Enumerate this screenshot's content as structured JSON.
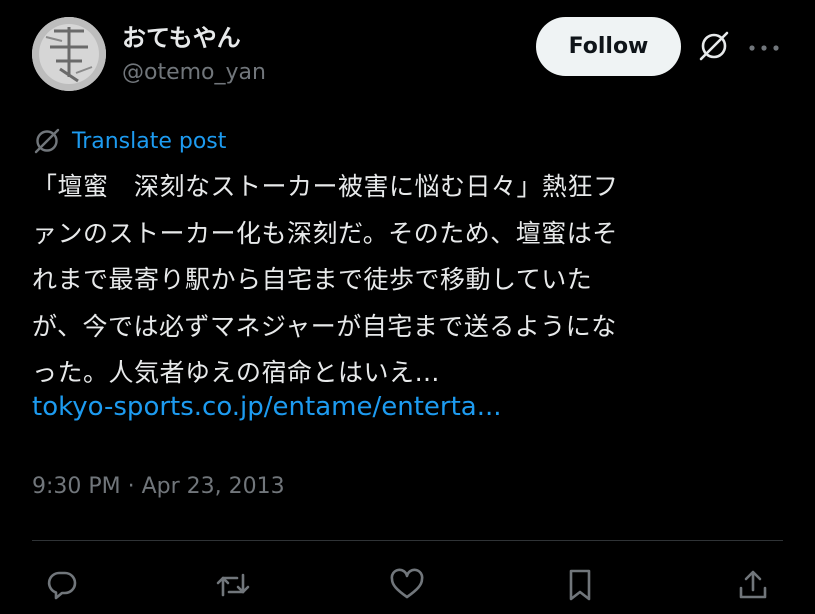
{
  "author": {
    "display_name": "おてもやん",
    "handle": "@otemo_yan"
  },
  "header": {
    "follow_label": "Follow"
  },
  "translate": {
    "label": "Translate post"
  },
  "post": {
    "lines": [
      "「壇蜜　深刻なストーカー被害に悩む日々」熱狂フ",
      "ァンのストーカー化も深刻だ。そのため、壇蜜はそ",
      "れまで最寄り駅から自宅まで徒歩で移動していた",
      "が、今では必ずマネジャーが自宅まで送るようにな",
      "った。人気者ゆえの宿命とはいえ…"
    ],
    "link_text": "tokyo-sports.co.jp/entame/enterta...",
    "timestamp": "9:30 PM · Apr 23, 2013"
  },
  "actions": [
    {
      "icon": "reply-icon"
    },
    {
      "icon": "repost-icon"
    },
    {
      "icon": "like-icon"
    },
    {
      "icon": "bookmark-icon"
    },
    {
      "icon": "share-icon"
    }
  ],
  "colors": {
    "background": "#000000",
    "text_primary": "#e7e9ea",
    "text_secondary": "#71767b",
    "link": "#1d9bf0",
    "follow_bg": "#eff3f4",
    "divider": "#2f3336"
  }
}
